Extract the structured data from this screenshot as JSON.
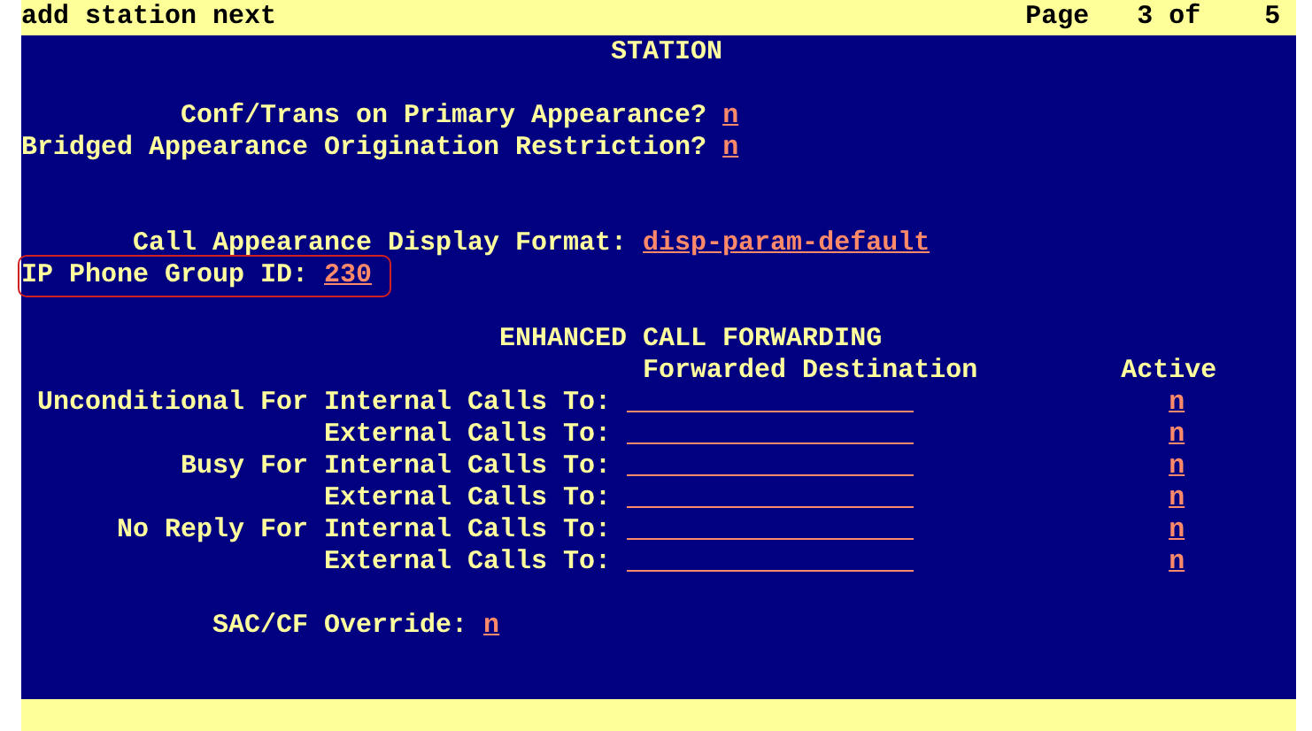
{
  "command": "add station next",
  "page": {
    "label": "Page",
    "current": "3 of",
    "total": "5"
  },
  "title": "STATION",
  "fields": [
    {
      "label": "Conf/Trans on Primary Appearance?",
      "value": "n",
      "highlighted": false
    },
    {
      "label": "Bridged Appearance Origination Restriction?",
      "value": "n",
      "highlighted": false
    },
    {
      "label": "Call Appearance Display Format:",
      "value": "disp-param-default",
      "highlighted": false
    },
    {
      "label": "IP Phone Group ID:",
      "value": "230",
      "highlighted": true
    }
  ],
  "forwarding": {
    "title": "ENHANCED CALL FORWARDING",
    "columns": [
      "Forwarded Destination",
      "Active"
    ],
    "rows": [
      {
        "condition": "Unconditional For",
        "label": "Internal Calls To:",
        "active": "n"
      },
      {
        "label": "External Calls To:",
        "active": "n"
      },
      {
        "condition": "Busy For",
        "label": "Internal Calls To:",
        "active": "n"
      },
      {
        "label": "External Calls To:",
        "active": "n"
      },
      {
        "condition": "No Reply For",
        "label": "Internal Calls To:",
        "active": "n"
      },
      {
        "label": "External Calls To:",
        "active": "n"
      }
    ]
  },
  "override": {
    "label": "SAC/CF Override:",
    "value": "n"
  }
}
